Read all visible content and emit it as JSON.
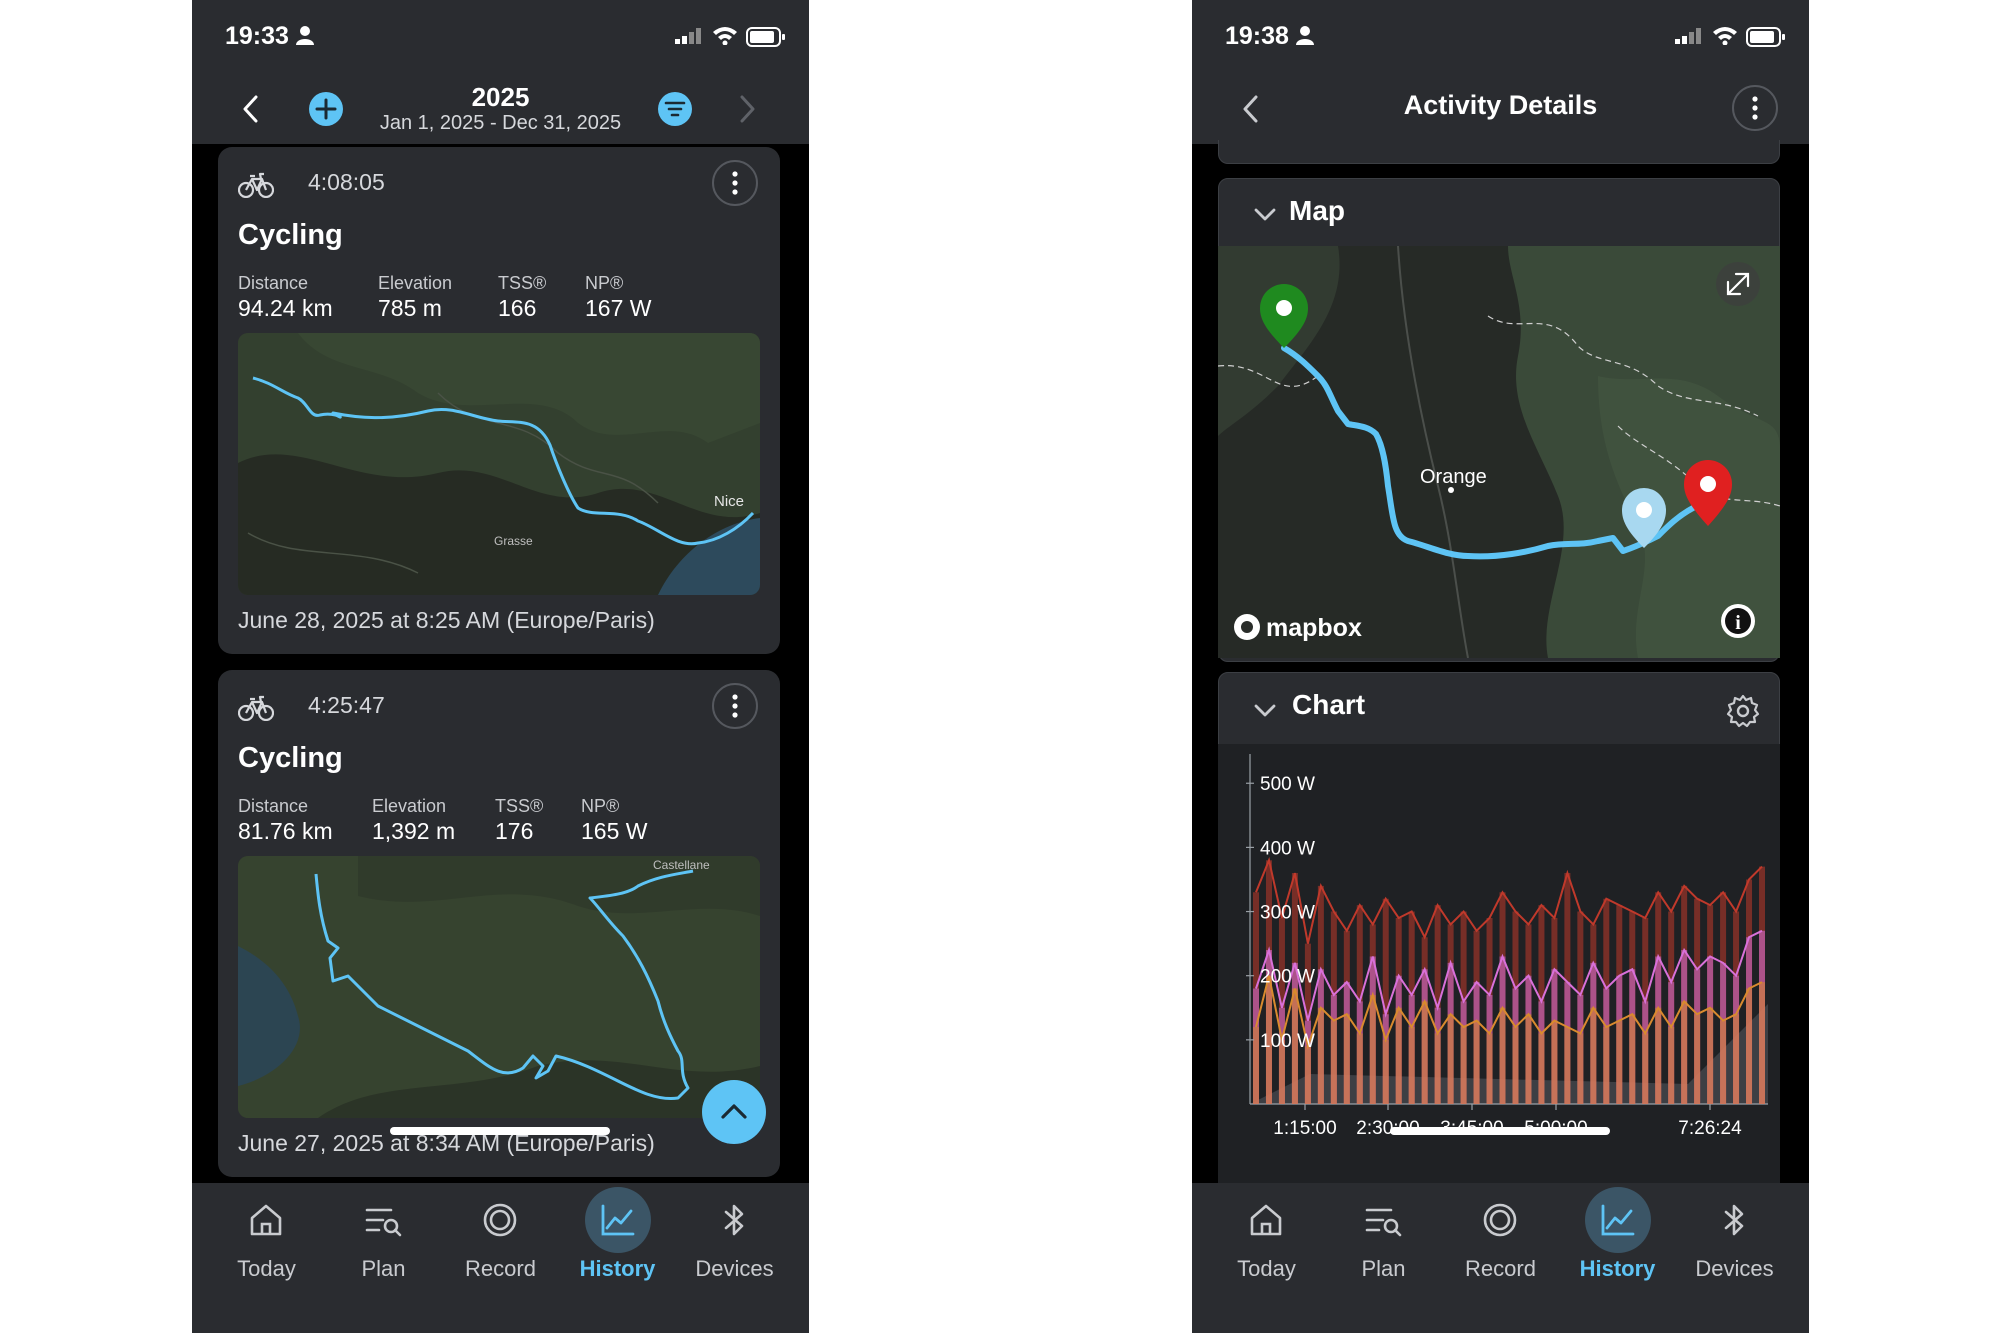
{
  "left_screen": {
    "status": {
      "time": "19:33"
    },
    "header": {
      "year": "2025",
      "range": "Jan 1, 2025 - Dec 31, 2025"
    },
    "activities": [
      {
        "duration": "4:08:05",
        "title": "Cycling",
        "stats": [
          {
            "label": "Distance",
            "value": "94.24 km"
          },
          {
            "label": "Elevation",
            "value": "785 m"
          },
          {
            "label": "TSS®",
            "value": "166"
          },
          {
            "label": "NP®",
            "value": "167 W"
          }
        ],
        "map_labels": {
          "city": "Nice",
          "town": "Grasse"
        },
        "date": "June 28, 2025 at 8:25 AM (Europe/Paris)"
      },
      {
        "duration": "4:25:47",
        "title": "Cycling",
        "stats": [
          {
            "label": "Distance",
            "value": "81.76 km"
          },
          {
            "label": "Elevation",
            "value": "1,392 m"
          },
          {
            "label": "TSS®",
            "value": "176"
          },
          {
            "label": "NP®",
            "value": "165 W"
          }
        ],
        "map_labels": {
          "town": "Castellane"
        },
        "date": "June 27, 2025 at 8:34 AM (Europe/Paris)"
      }
    ]
  },
  "right_screen": {
    "status": {
      "time": "19:38"
    },
    "header": {
      "title": "Activity Details"
    },
    "map_panel": {
      "title": "Map",
      "place_label": "Orange",
      "attribution": "mapbox",
      "info_glyph": "i"
    },
    "chart_panel": {
      "title": "Chart"
    }
  },
  "chart_data": {
    "type": "line",
    "title": "",
    "y_tick_labels": [
      "500 W",
      "400 W",
      "300 W",
      "200 W",
      "100 W"
    ],
    "y_ticks": [
      500,
      400,
      300,
      200,
      100
    ],
    "x_tick_labels": [
      "1:15:00",
      "2:30:00",
      "3:45:00",
      "5:00:00",
      "7:26:24"
    ],
    "ylim": [
      0,
      530
    ],
    "series": [
      {
        "color": "#c0392b",
        "y": [
          330,
          380,
          290,
          360,
          250,
          340,
          300,
          270,
          310,
          280,
          320,
          290,
          300,
          260,
          310,
          280,
          300,
          270,
          290,
          330,
          300,
          280,
          310,
          290,
          360,
          300,
          280,
          320,
          310,
          300,
          290,
          330,
          300,
          340,
          320,
          310,
          330,
          300,
          350,
          370
        ]
      },
      {
        "color": "#d970d9",
        "y": [
          180,
          240,
          150,
          220,
          130,
          210,
          170,
          190,
          160,
          230,
          140,
          200,
          170,
          210,
          150,
          220,
          160,
          190,
          170,
          230,
          180,
          200,
          160,
          210,
          190,
          170,
          220,
          180,
          200,
          210,
          160,
          230,
          190,
          240,
          210,
          230,
          220,
          200,
          260,
          270
        ]
      },
      {
        "color": "#d98a2e",
        "y": [
          120,
          200,
          100,
          180,
          90,
          150,
          130,
          140,
          110,
          170,
          100,
          150,
          120,
          160,
          110,
          140,
          120,
          130,
          110,
          150,
          120,
          140,
          110,
          130,
          120,
          110,
          150,
          120,
          130,
          140,
          110,
          150,
          120,
          160,
          140,
          150,
          130,
          140,
          180,
          190
        ]
      }
    ],
    "grid": false
  },
  "tabs": [
    {
      "label": "Today",
      "icon": "home-icon"
    },
    {
      "label": "Plan",
      "icon": "plan-search-icon"
    },
    {
      "label": "Record",
      "icon": "record-icon"
    },
    {
      "label": "History",
      "icon": "history-chart-icon"
    },
    {
      "label": "Devices",
      "icon": "bluetooth-icon"
    }
  ],
  "colors": {
    "accent": "#5ec4f5",
    "surface": "#2a2c30",
    "route": "#5ec4f5",
    "start_pin": "#1f8a1f",
    "end_pin": "#e02020"
  }
}
